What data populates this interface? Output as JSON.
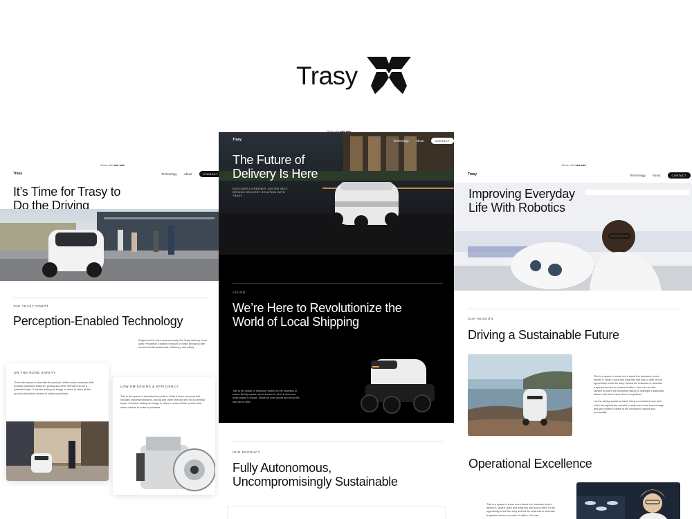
{
  "brand": {
    "name": "Trasy",
    "logo_icon": "trasy-star-logo-icon"
  },
  "captions": {
    "left": "Made with ■■■ ■■■",
    "center": "Made with ■■■ ■■■",
    "right": "Made with ■■■ ■■■"
  },
  "nav": {
    "logo": "Trasy",
    "technology": "Technology",
    "about": "About",
    "contact": "CONTACT"
  },
  "left_page": {
    "hero_title": "It’s Time for Trasy to\nDo the Driving",
    "eyebrow": "THE TRASY ROBOT",
    "section_title": "Perception-Enabled Technology",
    "section_body": "Engineered to drive autonomously, the Trasy delivery robot uses Perception Enabled Sensors to make decisions with environmental awareness, efficiency, and safety.",
    "card1_title": "ON THE ROAD SAFETY",
    "card1_body": "This is the space to describe the product. Write a short overview that includes important features, pricing and other relevant info for a potential buyer. Consider adding an image or video to show off the product and entice visitors to make a purchase.",
    "card2_title": "LOW EMISSIONS & EFFICIENCY",
    "card2_body": "This is the space to describe the product. Write a short overview that includes important features, pricing and other relevant info for a potential buyer. Consider adding an image or video to show off the product and entice visitors to make a purchase."
  },
  "center_page": {
    "hero_title": "The Future of\nDelivery Is Here",
    "hero_sub": "DISCOVER A GREENER, FASTER SELF-DRIVING DELIVERY SOLUTION WITH TRASY.",
    "vision_eyebrow": "VISION",
    "vision_title": "We’re Here to Revolutionize the\nWorld of Local Shipping",
    "vision_body": "This is the space to introduce visitors to the business or brand. Briefly explain who's behind it, what it does and what makes it unique. Share its core values and what this site has to offer.",
    "product_eyebrow": "OUR PRODUCT",
    "product_title": "Fully Autonomous,\nUncompromisingly Sustainable"
  },
  "right_page": {
    "hero_title": "Improving Everyday\nLife With Robotics",
    "mission_eyebrow": "OUR MISSION",
    "mission_title": "Driving a Sustainable Future",
    "mission_body": "This is a space to share more about the business: who's behind it, what it does and what this site has to offer. It's an opportunity to tell the story behind the business or describe a special service or product it offers. You can use this section to share the company history or highlight a particular feature that sets it apart from competitors.\n\nLet the writing speak for itself. Keep a consistent tone and voice throughout the website to stay true to the brand image and give visitors a taste of the company's values and personality.",
    "ops_title": "Operational Excellence",
    "ops_body": "This is a space to share more about the business: who's behind it, what it does and what this site has to offer. It's an opportunity to tell the story behind the business or describe a special service or product it offers. You can"
  },
  "colors": {
    "ink": "#111111",
    "dark_panel": "#050505",
    "accent_light": "#f2a64a"
  }
}
